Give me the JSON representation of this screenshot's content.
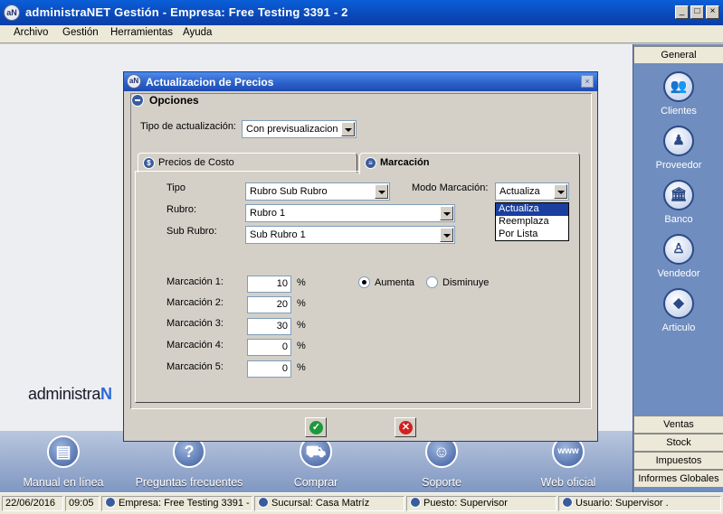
{
  "window": {
    "title": "administraNET Gestión - Empresa: Free Testing 3391 - 2",
    "icon_text": "aN",
    "minimize": "_",
    "maximize": "□",
    "close": "×"
  },
  "menu": [
    "Archivo",
    "Gestión",
    "Herramientas",
    "Ayuda"
  ],
  "logo": {
    "text": "administra",
    "accent": "N"
  },
  "bottom_tools": [
    {
      "label": "Manual en línea",
      "icon": "book-icon",
      "glyph": "▤"
    },
    {
      "label": "Preguntas frecuentes",
      "icon": "question-icon",
      "glyph": "?"
    },
    {
      "label": "Comprar",
      "icon": "cart-icon",
      "glyph": "⛟"
    },
    {
      "label": "Soporte",
      "icon": "headset-icon",
      "glyph": "☺"
    },
    {
      "label": "Web oficial",
      "icon": "web-icon",
      "glyph": "www"
    }
  ],
  "right_panel": {
    "top_tab": "General",
    "items": [
      {
        "label": "Clientes",
        "icon": "clients-icon",
        "glyph": "👥"
      },
      {
        "label": "Proveedor",
        "icon": "supplier-icon",
        "glyph": "♟"
      },
      {
        "label": "Banco",
        "icon": "bank-icon",
        "glyph": "🏛"
      },
      {
        "label": "Vendedor",
        "icon": "seller-icon",
        "glyph": "♙"
      },
      {
        "label": "Articulo",
        "icon": "article-icon",
        "glyph": "◆"
      }
    ],
    "bottom_tabs": [
      "Ventas",
      "Stock",
      "Impuestos",
      "Informes Globales"
    ]
  },
  "status": {
    "date": "22/06/2016",
    "time": "09:05",
    "empresa": "Empresa: Free Testing 3391 -",
    "sucursal": "Sucursal: Casa Matríz",
    "puesto": "Puesto: Supervisor",
    "usuario": "Usuario: Supervisor ."
  },
  "dialog": {
    "title": "Actualizacion de Precios",
    "icon_text": "aN",
    "close": "×",
    "group_title": "Opciones",
    "tipo_actualizacion_label": "Tipo de actualización:",
    "tipo_actualizacion_value": "Con previsualizacion",
    "tabs": [
      {
        "label": "Precios de Costo",
        "icon": "dollar-icon",
        "glyph": "$"
      },
      {
        "label": "Marcación",
        "icon": "percent-icon",
        "glyph": "≡"
      }
    ],
    "tipo_label": "Tipo",
    "tipo_value": "Rubro Sub Rubro",
    "rubro_label": "Rubro:",
    "rubro_value": "Rubro 1",
    "subrubro_label": "Sub Rubro:",
    "subrubro_value": "Sub Rubro 1",
    "modo_label": "Modo Marcación:",
    "modo_value": "Actualiza",
    "modo_options": [
      "Actualiza",
      "Reemplaza",
      "Por Lista"
    ],
    "marcaciones": [
      {
        "label": "Marcación 1:",
        "value": "10",
        "unit": "%"
      },
      {
        "label": "Marcación 2:",
        "value": "20",
        "unit": "%"
      },
      {
        "label": "Marcación 3:",
        "value": "30",
        "unit": "%"
      },
      {
        "label": "Marcación 4:",
        "value": "0",
        "unit": "%"
      },
      {
        "label": "Marcación 5:",
        "value": "0",
        "unit": "%"
      }
    ],
    "aumenta_label": "Aumenta",
    "disminuye_label": "Disminuye",
    "ok_glyph": "✓",
    "cancel_glyph": "✕"
  },
  "colors": {
    "titlebar": "#0a48b8",
    "panel": "#6f8dbf",
    "ok_green": "#1a9a3a",
    "cancel_red": "#d02020"
  }
}
